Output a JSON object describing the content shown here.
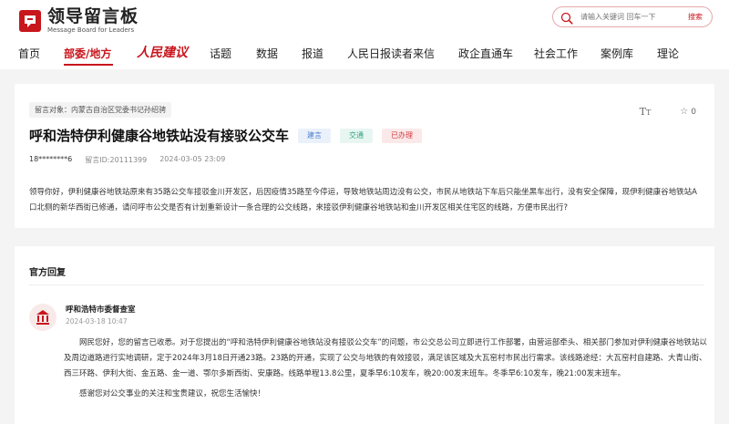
{
  "header": {
    "logo_title": "领导留言板",
    "logo_subtitle": "Message Board for Leaders",
    "search_placeholder": "请输入关键词 回车一下",
    "search_button": "搜索"
  },
  "nav": {
    "items": [
      "首页",
      "部委/地方",
      "人民建议",
      "话题",
      "数据",
      "报道",
      "人民日报读者来信",
      "政企直通车",
      "社会工作",
      "案例库",
      "理论"
    ],
    "active": "部委/地方"
  },
  "message": {
    "target": "留言对象：内蒙古自治区党委书记孙绍骋",
    "title": "呼和浩特伊利健康谷地铁站没有接驳公交车",
    "tags": [
      "建言",
      "交通",
      "已办理"
    ],
    "favorites": "0",
    "user": "18********6",
    "message_id": "留言ID:20111399",
    "time": "2024-03-05 23:09",
    "body": "领导你好，伊利健康谷地铁站原来有35路公交车接驳金川开发区，后因疫情35路至今停运，导致地铁站周边没有公交，市民从地铁站下车后只能坐黑车出行，没有安全保障，现伊利健康谷地铁站A口北侧的新华西街已修通，请问呼市公交是否有计划重新设计一条合理的公交线路，来接驳伊利健康谷地铁站和金川开发区相关住宅区的线路，方便市民出行?"
  },
  "reply": {
    "heading": "官方回复",
    "org": "呼和浩特市委督查室",
    "time": "2024-03-18 10:47",
    "body": "网民您好，您的留言已收悉。对于您提出的“呼和浩特伊利健康谷地铁站没有接驳公交车”的问题，市公交总公司立即进行工作部署，由营运部牵头、相关部门参加对伊利健康谷地铁站以及周边道路进行实地调研，定于2024年3月18日开通23路。23路的开通，实现了公交与地铁的有效接驳，满足该区域及大瓦窑村市民出行需求。该线路途经：大瓦窑村自建路、大青山街、西三环路、伊利大街、金五路、金一道、鄂尔多斯西街、安康路。线路单程13.8公里，夏季早6:10发车，晚20:00发末班车。冬季早6:10发车，晚21:00发末班车。",
    "thanks": "感谢您对公交事业的关注和宝贵建议，祝您生活愉快！"
  },
  "colors": {
    "brand_red": "#c8161d",
    "tag_blue": "#4a7cc9",
    "tag_green": "#31a37f",
    "tag_red": "#d4393f"
  },
  "icons": [
    "logo-mark-icon",
    "search-icon",
    "font-size-icon",
    "star-icon",
    "org-emblem-icon"
  ]
}
